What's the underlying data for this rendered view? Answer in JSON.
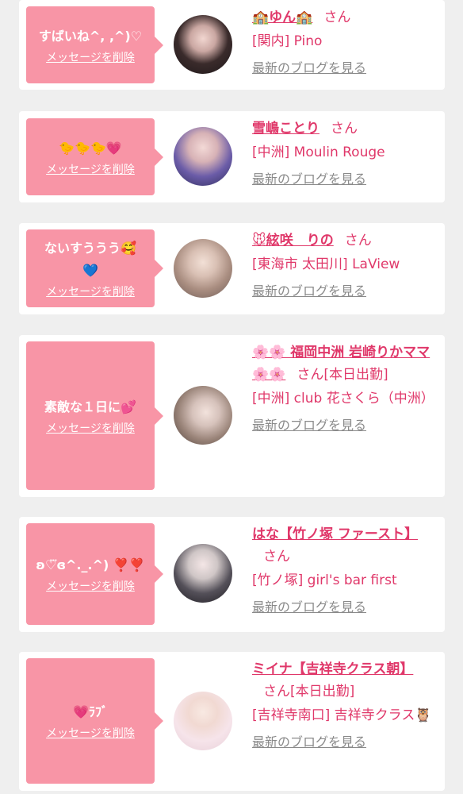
{
  "cards": [
    {
      "message": "すばいね^, ,^)♡",
      "delete_label": "メッセージを削除",
      "name": "🏫ゆん🏫",
      "san": "さん",
      "shop": "[関内] Pino",
      "blog_label": "最新のブログを見る"
    },
    {
      "message": "🐤🐤🐤💗",
      "delete_label": "メッセージを削除",
      "name": "雪嶋ことり",
      "san": "さん",
      "shop": "[中洲] Moulin Rouge",
      "blog_label": "最新のブログを見る"
    },
    {
      "message": "ないすううう🥰💙",
      "delete_label": "メッセージを削除",
      "name": "🐭絃咲　りの",
      "san": "さん",
      "shop": "[東海市 太田川] LaView",
      "blog_label": "最新のブログを見る"
    },
    {
      "message": "素敵な１日に💕",
      "delete_label": "メッセージを削除",
      "name": "🌸🌸 福岡中洲 岩崎りかママ 🌸🌸",
      "san": "さん[本日出勤]",
      "shop": "[中洲] club 花さくら（中洲）",
      "blog_label": "最新のブログを見る"
    },
    {
      "message": "ʚ♡⃛ɞ^._.^) ❣️❣️",
      "delete_label": "メッセージを削除",
      "name": "はな【竹ノ塚 ファースト】",
      "san": "さん",
      "shop": "[竹ノ塚] girl's bar first",
      "blog_label": "最新のブログを見る"
    },
    {
      "message": "💗ﾗﾌﾞ",
      "delete_label": "メッセージを削除",
      "name": "ミイナ【吉祥寺クラス朝】",
      "san": "さん[本日出勤]",
      "shop": "[吉祥寺南口] 吉祥寺クラス🦉",
      "blog_label": "最新のブログを見る"
    }
  ],
  "colors": {
    "page_background": "#efefef",
    "bubble": "#f895a6",
    "name_link": "#e0386a",
    "blog_link": "#8a8a8a"
  }
}
